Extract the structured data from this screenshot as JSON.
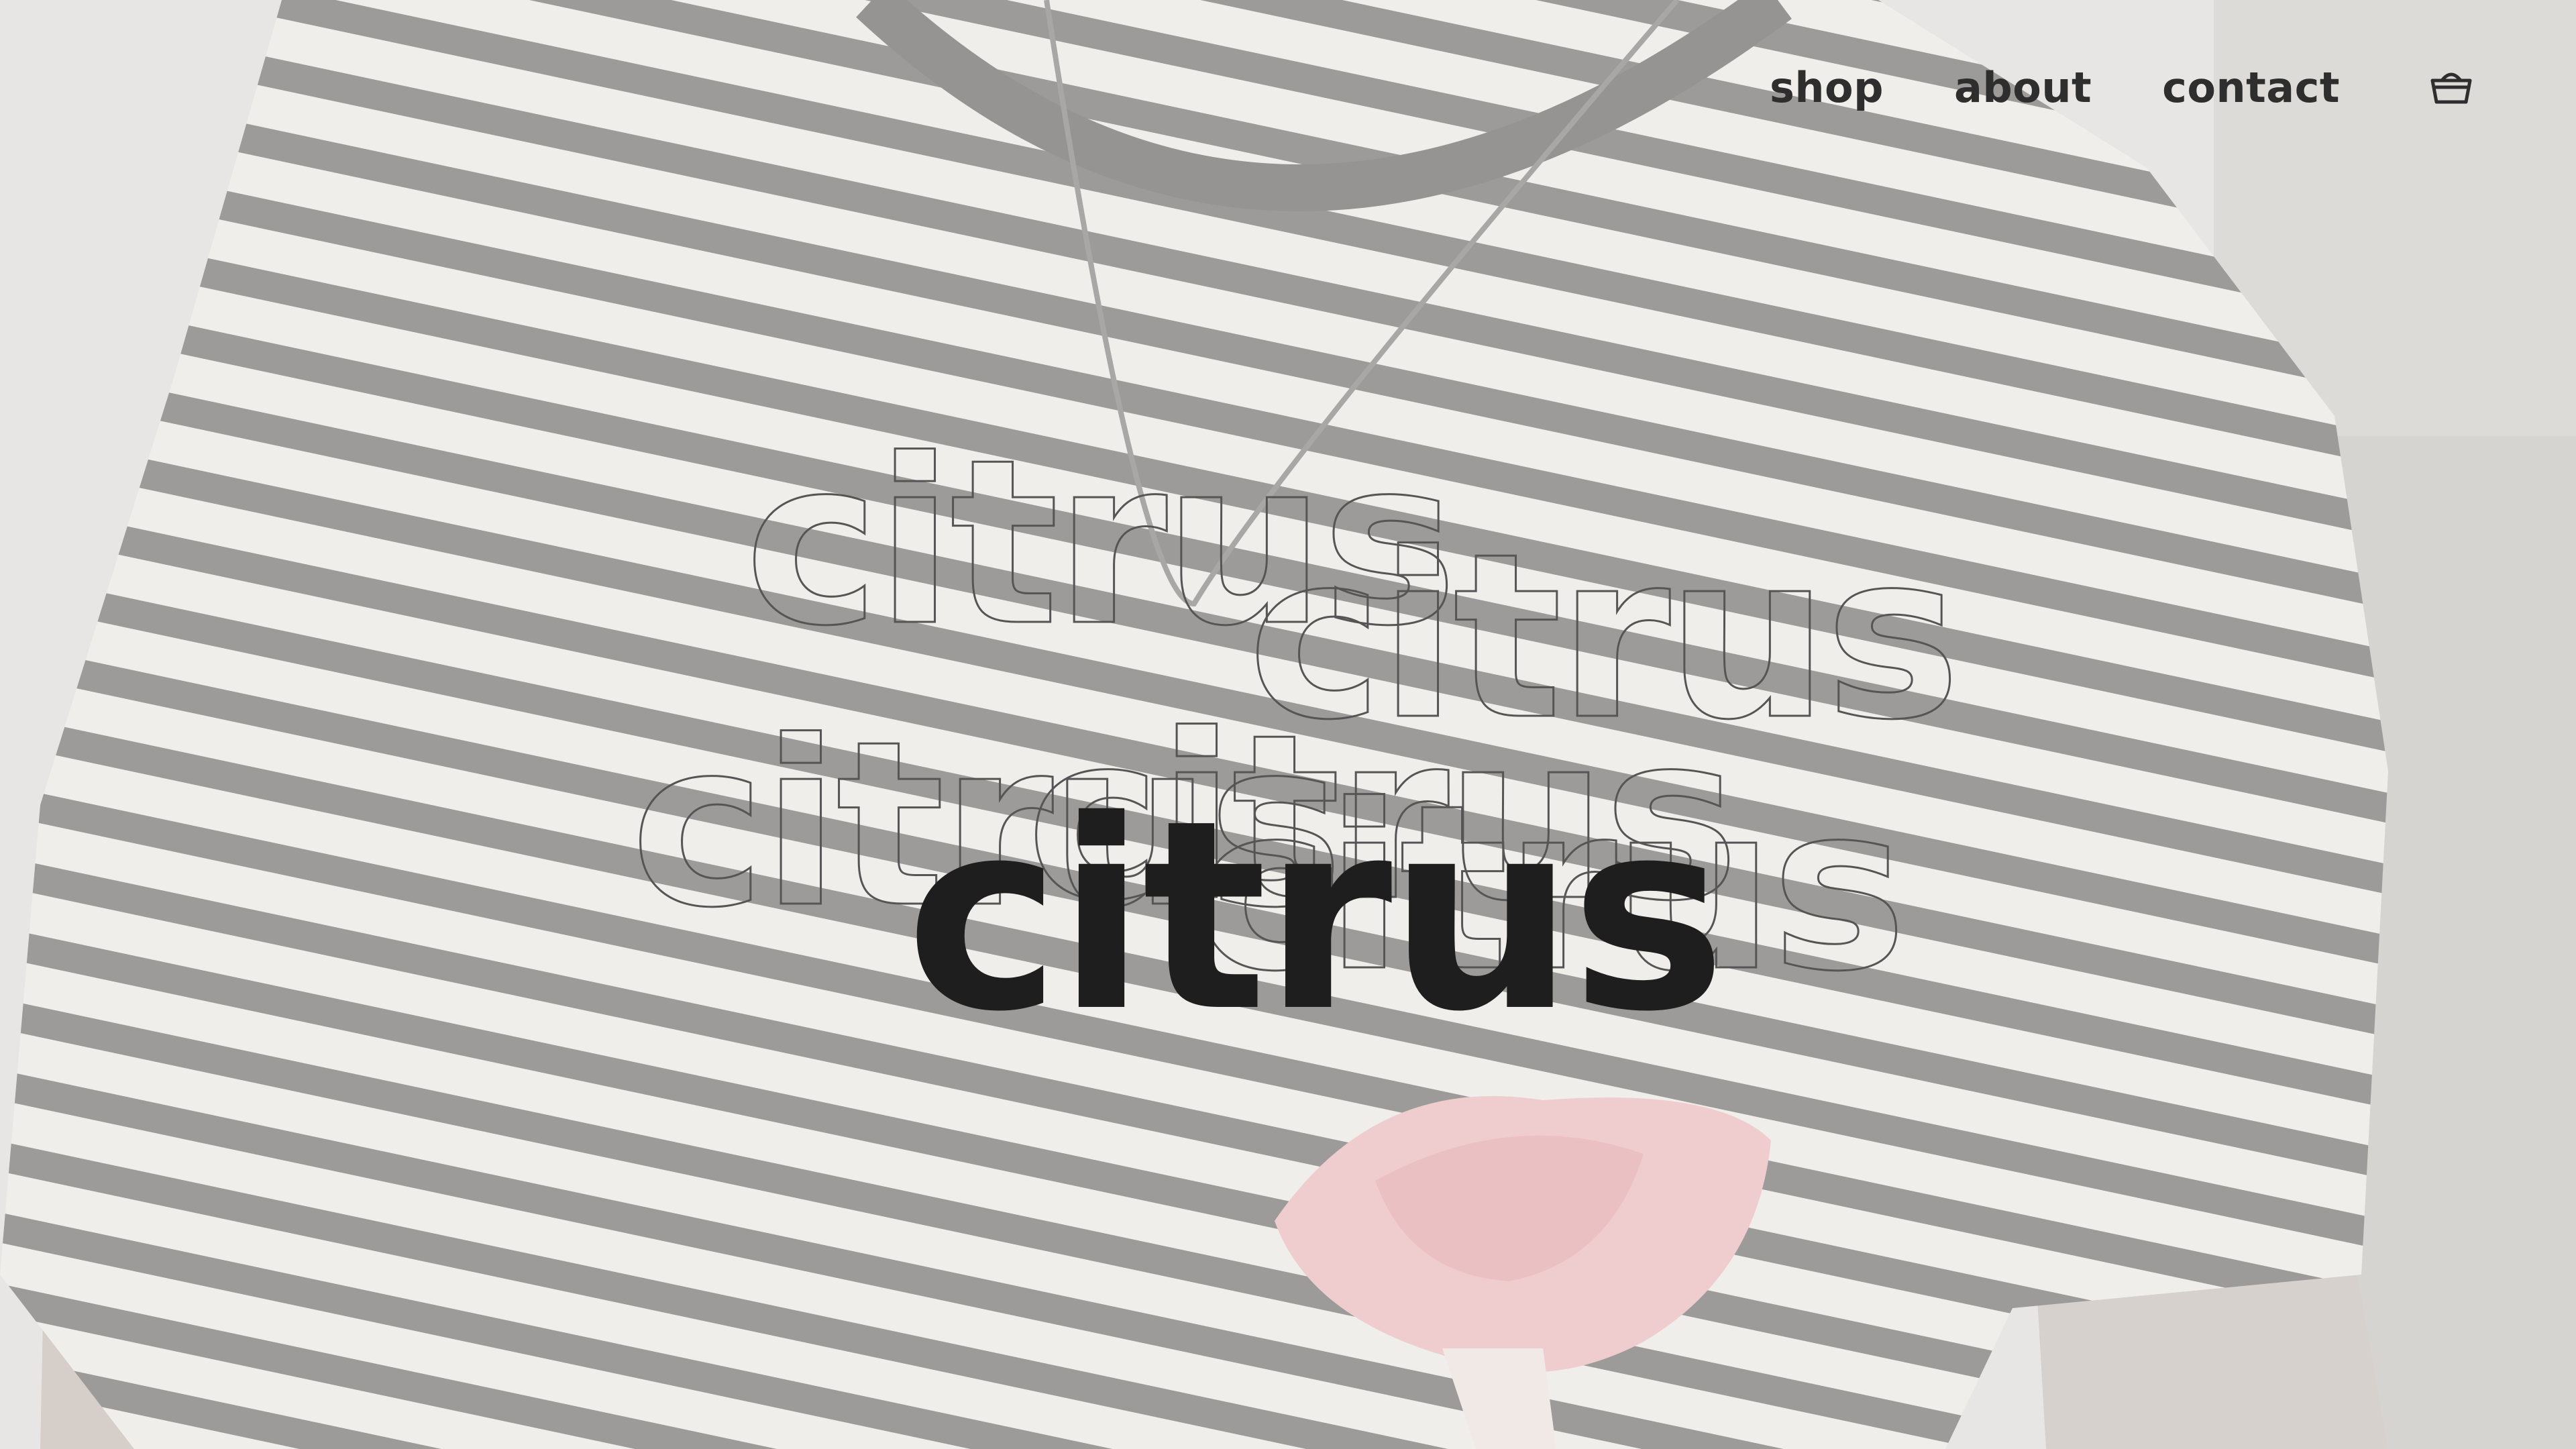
{
  "nav": {
    "links": [
      {
        "label": "shop"
      },
      {
        "label": "about"
      },
      {
        "label": "contact"
      }
    ],
    "cart_icon": "shopping-basket-icon"
  },
  "hero": {
    "brand": "citrus",
    "outline_copies": [
      "citrus",
      "citrus",
      "citrus",
      "citrus",
      "citrus"
    ]
  },
  "colors": {
    "overlay": "#ecebe9",
    "stripe_dark": "#3a3a3a",
    "stripe_light": "#f4f2ec",
    "text_dark": "#1e1e1e",
    "nav_text": "#2e2e2e",
    "rose": "#f2a9ae"
  }
}
